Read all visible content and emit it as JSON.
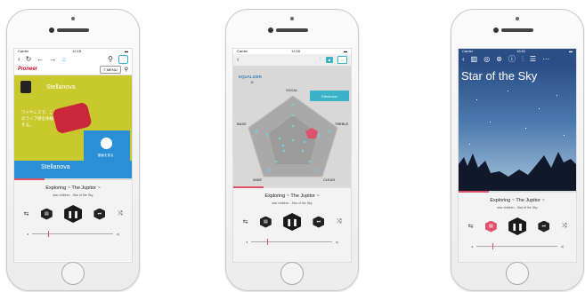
{
  "phone1": {
    "status": {
      "carrier": "Carrier",
      "time": "12:15"
    },
    "site_logo": "Pioneer",
    "menu_label": "MENU",
    "banner": {
      "brand": "Stellanova",
      "jp_text": "ワイヤレスで、このライブ感を体験する。",
      "video_caption": "動画を見る",
      "brand_bottom": "Stellanova"
    },
    "track_title": "Exploring ~ The Jupitor ~",
    "track_subtitle": "star children - Star of the Sky",
    "progress": 0.26,
    "volume": 0.2
  },
  "phone2": {
    "status": {
      "carrier": "Carrier",
      "time": "12:16"
    },
    "eq_title": "EQUALIZER",
    "eq_sub": "B",
    "preset": "Electronic",
    "bands": [
      "VOCAL",
      "TREBLE",
      "CLEAR",
      "WIDE",
      "BASS"
    ],
    "track_title": "Exploring ~ The Jupitor ~",
    "track_subtitle": "star children - Star of the Sky",
    "progress": 0.26,
    "volume": 0.2
  },
  "phone3": {
    "status": {
      "carrier": "Carrier",
      "time": "16:52"
    },
    "sky_title": "Star of the Sky",
    "track_title": "Exploring ~ The Jupitor ~",
    "track_subtitle": "star children - Star of the Sky",
    "progress": 0.26,
    "volume": 0.2
  },
  "colors": {
    "accent": "#3ab3c9",
    "highlight": "#e0526c",
    "brand_red": "#c8102e"
  },
  "icons": [
    "repeat-icon",
    "full-icon",
    "pause-icon",
    "next-icon",
    "shuffle-icon",
    "back-icon",
    "refresh-icon",
    "settings-icon"
  ]
}
